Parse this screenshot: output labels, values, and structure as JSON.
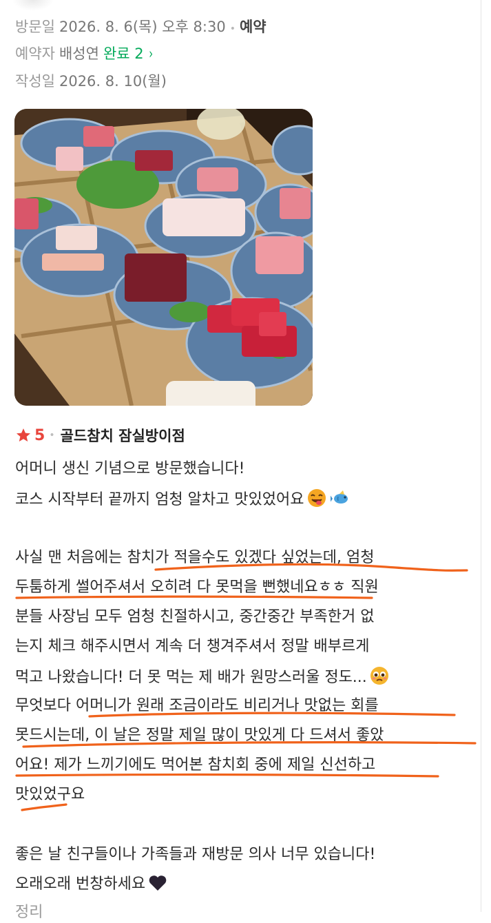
{
  "visit": {
    "label": "방문일",
    "value": "2026. 8. 6(목) 오후 8:30",
    "type": "예약"
  },
  "reserver": {
    "label": "예약자",
    "name": "배성연",
    "status": "완료 2"
  },
  "written": {
    "label": "작성일",
    "value": "2026. 8. 10(월)"
  },
  "review": {
    "rating": "5",
    "store_name": "골드참치 잠실방이점",
    "lines": [
      "어머니 생신 기념으로 방문했습니다!",
      "코스 시작부터 끝까지 엄청 알차고 맛있었어요",
      "사실 맨 처음에는 참치가 적을수도 있겠다 싶었는데, 엄청",
      "두툼하게 썰어주셔서 오히려 다 못먹을 뻔했네요ㅎㅎ 직원",
      "분들 사장님 모두 엄청 친절하시고, 중간중간 부족한거 없",
      "는지 체크 해주시면서 계속 더 챙겨주셔서 정말 배부르게",
      "먹고 나왔습니다! 더 못 먹는 제 배가 원망스러울 정도...",
      "무엇보다 어머니가 원래 조금이라도 비리거나 맛없는 회를",
      "못드시는데, 이 날은 정말 제일 많이 맛있게 다 드셔서 좋았",
      "어요! 제가 느끼기에도 먹어본 참치회 중에 제일 신선하고",
      "맛있었구요",
      "좋은 날 친구들이나 가족들과 재방문 의사 너무 있습니다!",
      "오래오래 번창하세요",
      "정리"
    ]
  },
  "icons": {
    "star": "star-icon",
    "chevron": "chevron-right-icon",
    "emoji_face": "savoring-face-emoji",
    "emoji_fish": "fish-emoji",
    "emoji_pleading": "pleading-face-emoji",
    "emoji_heart": "black-heart-emoji"
  },
  "colors": {
    "accent_green": "#03aa5a",
    "star_red": "#e8453c",
    "annotation_orange": "#f0621b",
    "meta_gray": "#9a9a9a"
  }
}
